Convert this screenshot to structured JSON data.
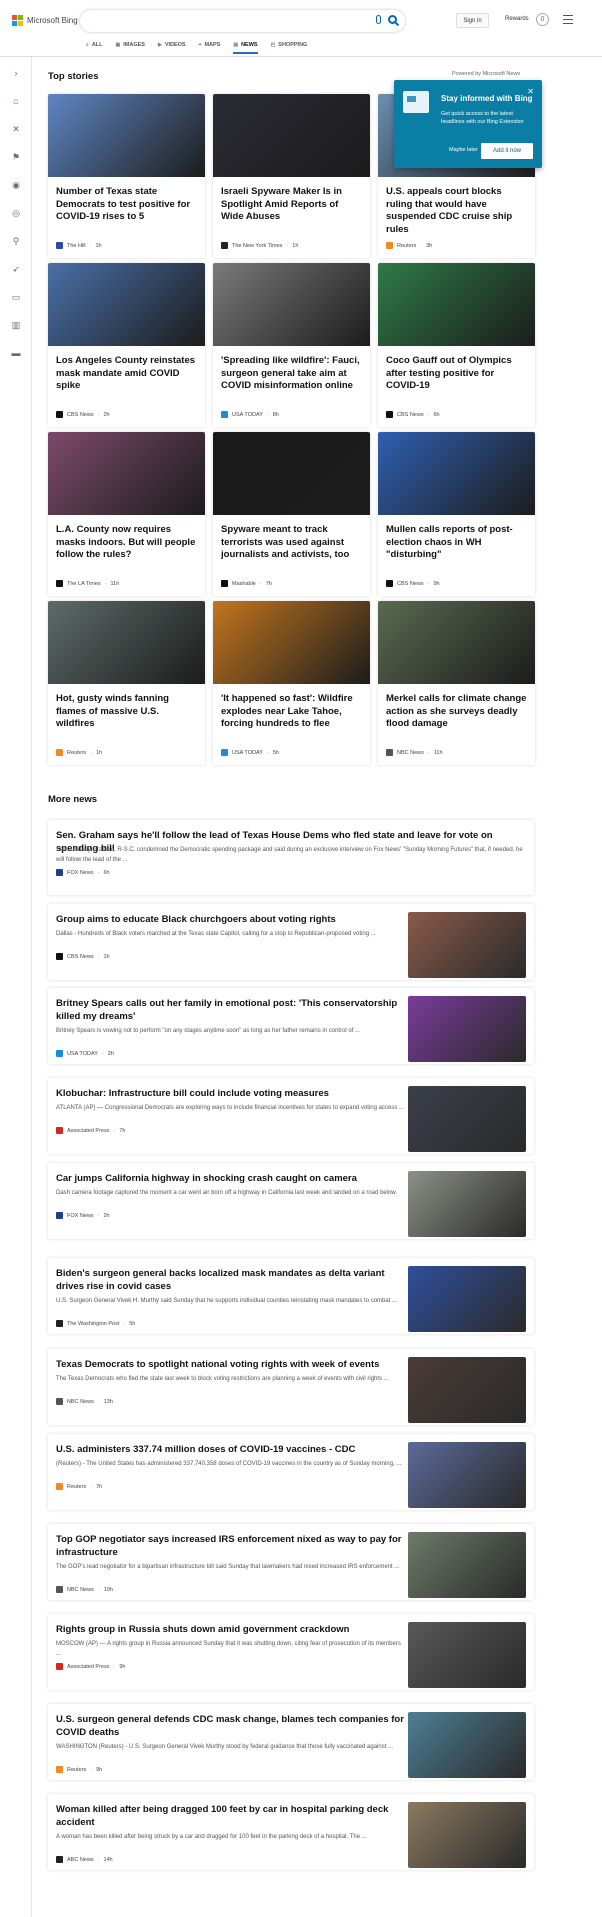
{
  "header": {
    "logo_text": "Microsoft Bing",
    "sign_in": "Sign in",
    "rewards": "Rewards",
    "rewards_badge": "0",
    "tabs": [
      {
        "label": "ALL",
        "icon": "search-icon"
      },
      {
        "label": "IMAGES",
        "icon": "image-icon"
      },
      {
        "label": "VIDEOS",
        "icon": "video-icon"
      },
      {
        "label": "MAPS",
        "icon": "map-pin-icon"
      },
      {
        "label": "NEWS",
        "icon": "news-icon",
        "active": true
      },
      {
        "label": "SHOPPING",
        "icon": "shopping-bag-icon"
      }
    ]
  },
  "sidebar": {
    "icons": [
      "expand-arrow-icon",
      "home-icon",
      "tools-icon",
      "flag-icon",
      "location-icon",
      "globe-icon",
      "microscope-icon",
      "rocket-icon",
      "film-icon",
      "bank-icon",
      "card-icon"
    ]
  },
  "top_stories": {
    "heading": "Top stories",
    "powered": "Powered by Microsoft News",
    "cards": [
      {
        "title": "Number of Texas state Democrats to test positive for COVID-19 rises to 5",
        "source": "The Hill",
        "time": "1h",
        "icon_color": "#2b4aa0",
        "img_color": "#5f86c4"
      },
      {
        "title": "Israeli Spyware Maker Is in Spotlight Amid Reports of Wide Abuses",
        "source": "The New York Times",
        "time": "1h",
        "icon_color": "#222222",
        "img_color": "#2b2b34"
      },
      {
        "title": "U.S. appeals court blocks ruling that would have suspended CDC cruise ship rules",
        "source": "Reuters",
        "time": "3h",
        "icon_color": "#f08a24",
        "img_color": "#6b8fb2"
      },
      {
        "title": "Los Angeles County reinstates mask mandate amid COVID spike",
        "source": "CBS News",
        "time": "2h",
        "icon_color": "#111111",
        "img_color": "#4a6fa8"
      },
      {
        "title": "'Spreading like wildfire': Fauci, surgeon general take aim at COVID misinformation online",
        "source": "USA TODAY",
        "time": "8h",
        "icon_color": "#1a8cd8",
        "img_color": "#7a7a7a"
      },
      {
        "title": "Coco Gauff out of Olympics after testing positive for COVID-19",
        "source": "CBS News",
        "time": "6h",
        "icon_color": "#111111",
        "img_color": "#2e7a46"
      },
      {
        "title": "L.A. County now requires masks indoors. But will people follow the rules?",
        "source": "The LA Times",
        "time": "11h",
        "icon_color": "#111111",
        "img_color": "#7d4a6a"
      },
      {
        "title": "Spyware meant to track terrorists was used against journalists and activists, too",
        "source": "Mashable",
        "time": "7h",
        "icon_color": "#111111",
        "img_color": "#1a1a1a"
      },
      {
        "title": "Mullen calls reports of post-election chaos in WH \"disturbing\"",
        "source": "CBS News",
        "time": "9h",
        "icon_color": "#111111",
        "img_color": "#2f5fb0"
      },
      {
        "title": "Hot, gusty winds fanning flames of massive U.S. wildfires",
        "source": "Reuters",
        "time": "1h",
        "icon_color": "#f08a24",
        "img_color": "#5d6b68"
      },
      {
        "title": "'It happened so fast': Wildfire explodes near Lake Tahoe, forcing hundreds to flee",
        "source": "USA TODAY",
        "time": "5h",
        "icon_color": "#1a8cd8",
        "img_color": "#c3751f"
      },
      {
        "title": "Merkel calls for climate change action as she surveys deadly flood damage",
        "source": "NBC News",
        "time": "11h",
        "icon_color": "#555555",
        "img_color": "#5a6a50"
      }
    ]
  },
  "popup": {
    "title": "Stay informed with Bing",
    "desc": "Get quick access to the latest headlines with our Bing Extension",
    "later": "Maybe later",
    "add": "Add it now"
  },
  "more_news": {
    "heading": "More news",
    "items": [
      {
        "title": "Sen. Graham says he'll follow the lead of Texas House Dems who fled state and leave for vote on spending bill",
        "snippet": "Sen. Lindsey Graham, R-S.C. condemned the Democratic spending package and said during an exclusive interview on Fox News' \"Sunday Morning Futures\" that, if needed, he will follow the lead of the ...",
        "source": "FOX News",
        "time": "6h",
        "icon_color": "#1d3f8c",
        "img_color": ""
      },
      {
        "title": "Group aims to educate Black churchgoers about voting rights",
        "snippet": "Dallas - Hundreds of Black voters marched at the Texas state Capitol, calling for a stop to Republican-proposed voting ...",
        "source": "CBS News",
        "time": "1h",
        "icon_color": "#111111",
        "img_color": "#8a5b4a"
      },
      {
        "title": "Britney Spears calls out her family in emotional post: 'This conservatorship killed my dreams'",
        "snippet": "Britney Spears is vowing not to perform \"on any stages anytime soon\" as long as her father remains in control of ...",
        "source": "USA TODAY",
        "time": "2h",
        "icon_color": "#1a8cd8",
        "img_color": "#7a3a9c"
      },
      {
        "title": "Klobuchar: Infrastructure bill could include voting measures",
        "snippet": "ATLANTA (AP) — Congressional Democrats are exploring ways to include financial incentives for states to expand voting access ...",
        "source": "Associated Press",
        "time": "7h",
        "icon_color": "#d7261e",
        "img_color": "#3b3f4a"
      },
      {
        "title": "Car jumps California highway in shocking crash caught on camera",
        "snippet": "Dash camera footage captured the moment a car went air born off a highway in California last week and landed on a road below.",
        "source": "FOX News",
        "time": "2h",
        "icon_color": "#1d3f8c",
        "img_color": "#8d9088"
      },
      {
        "title": "Biden's surgeon general backs localized mask mandates as delta variant drives rise in covid cases",
        "snippet": "U.S. Surgeon General Vivek H. Murthy said Sunday that he supports individual counties reinstating mask mandates to combat ...",
        "source": "The Washington Post",
        "time": "5h",
        "icon_color": "#222222",
        "img_color": "#2f4f9c"
      },
      {
        "title": "Texas Democrats to spotlight national voting rights with week of events",
        "snippet": "The Texas Democrats who fled the state last week to block voting restrictions are planning a week of events with civil rights ...",
        "source": "NBC News",
        "time": "13h",
        "icon_color": "#555555",
        "img_color": "#4a3b38"
      },
      {
        "title": "U.S. administers 337.74 million doses of COVID-19 vaccines - CDC",
        "snippet": "(Reuters) - The United States has administered 337,740,358 doses of COVID-19 vaccines in the country as of Sunday morning, ...",
        "source": "Reuters",
        "time": "7h",
        "icon_color": "#f08a24",
        "img_color": "#5b6a9a"
      },
      {
        "title": "Top GOP negotiator says increased IRS enforcement nixed as way to pay for infrastructure",
        "snippet": "The GOP's lead negotiator for a bipartisan infrastructure bill said Sunday that lawmakers had nixed increased IRS enforcement ...",
        "source": "NBC News",
        "time": "10h",
        "icon_color": "#555555",
        "img_color": "#6d7b6a"
      },
      {
        "title": "Rights group in Russia shuts down amid government crackdown",
        "snippet": "MOSCOW (AP) — A rights group in Russia announced Sunday that it was shutting down, citing fear of prosecution of its members ...",
        "source": "Associated Press",
        "time": "9h",
        "icon_color": "#d7261e",
        "img_color": "#585858"
      },
      {
        "title": "U.S. surgeon general defends CDC mask change, blames tech companies for COVID deaths",
        "snippet": "WASHINGTON (Reuters) - U.S. Surgeon General Vivek Murthy stood by federal guidance that those fully vaccinated against ...",
        "source": "Reuters",
        "time": "9h",
        "icon_color": "#f08a24",
        "img_color": "#4d7f95"
      },
      {
        "title": "Woman killed after being dragged 100 feet by car in hospital parking deck accident",
        "snippet": "A woman has been killed after being struck by a car and dragged for 100 feet in the parking deck of a hospital. The ...",
        "source": "ABC News",
        "time": "14h",
        "icon_color": "#222222",
        "img_color": "#8b7a60"
      }
    ]
  }
}
